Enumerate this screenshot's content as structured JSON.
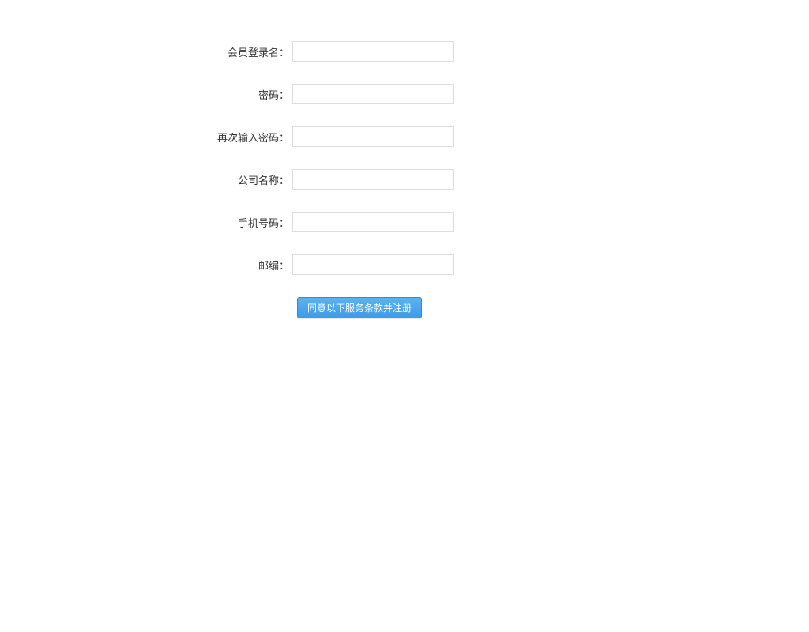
{
  "form": {
    "fields": [
      {
        "label": "会员登录名：",
        "name": "username",
        "value": ""
      },
      {
        "label": "密码：",
        "name": "password",
        "value": ""
      },
      {
        "label": "再次输入密码：",
        "name": "password-confirm",
        "value": ""
      },
      {
        "label": "公司名称：",
        "name": "company",
        "value": ""
      },
      {
        "label": "手机号码：",
        "name": "phone",
        "value": ""
      },
      {
        "label": "邮编：",
        "name": "zipcode",
        "value": ""
      }
    ],
    "submit_label": "同意以下服务条款并注册"
  }
}
